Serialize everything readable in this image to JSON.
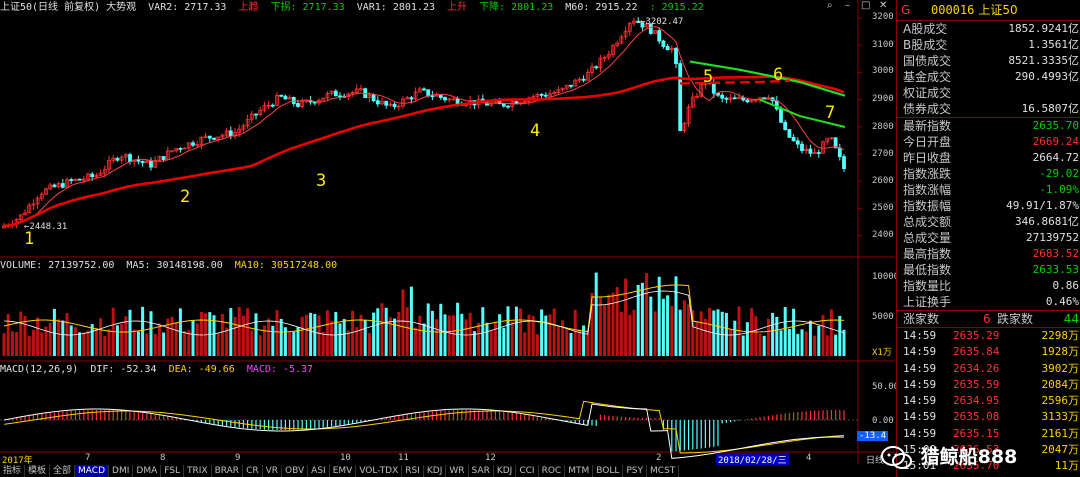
{
  "window": {
    "controls": [
      "⌕",
      "–",
      "□",
      "✕"
    ]
  },
  "main_header": {
    "title": "上证50(日线 前复权) 大势观",
    "var2": "VAR2: 2717.33",
    "up": "上趋",
    "down_arrow": "下拐: 2717.33",
    "var1": "VAR1: 2801.23",
    "up2": "上升",
    "down2": "下降: 2801.23",
    "m60": "M60: 2915.22",
    "m60b": ": 2915.22"
  },
  "volume_header": {
    "volume": "VOLUME: 27139752.00",
    "ma5": "MA5: 30148198.00",
    "ma10": "MA10: 30517248.00"
  },
  "macd_header": {
    "macd": "MACD(12,26,9)",
    "dif": "DIF: -52.34",
    "dea": "DEA: -49.66",
    "macdv": "MACD: -5.37"
  },
  "price_axis": [
    "3200",
    "3100",
    "3000",
    "2900",
    "2800",
    "2700",
    "2600",
    "2500",
    "2400"
  ],
  "volume_axis": [
    "10000",
    "5000"
  ],
  "volume_unit": "X1万",
  "macd_axis": [
    "50.00",
    "0.00"
  ],
  "macd_current": "-13.4",
  "x_labels": [
    "2017年",
    "7",
    "8",
    "9",
    "10",
    "11",
    "12",
    "2",
    "4"
  ],
  "cursor_date": "2018/02/28/三",
  "period": "日线",
  "annotations": {
    "high": "3202.47",
    "low": "2448.31",
    "marks": [
      "1",
      "2",
      "3",
      "4",
      "5",
      "6",
      "7"
    ]
  },
  "tabs": [
    "指标",
    "模板",
    "全部",
    "MACD",
    "DMI",
    "DMA",
    "FSL",
    "TRIX",
    "BRAR",
    "CR",
    "VR",
    "OBV",
    "ASI",
    "EMV",
    "VOL-TDX",
    "RSI",
    "KDJ",
    "WR",
    "SAR",
    "KDJ",
    "CCI",
    "ROC",
    "MTM",
    "BOLL",
    "PSY",
    "MCST"
  ],
  "active_tab": 3,
  "right_panel": {
    "g": "G",
    "code": "000016",
    "name": "上证50",
    "stats_a": [
      {
        "label": "A股成交",
        "value": "1852.9241亿",
        "color": "white"
      },
      {
        "label": "B股成交",
        "value": "1.3561亿",
        "color": "white"
      },
      {
        "label": "国债成交",
        "value": "8521.3335亿",
        "color": "white"
      },
      {
        "label": "基金成交",
        "value": "290.4993亿",
        "color": "white"
      },
      {
        "label": "权证成交",
        "value": "",
        "color": "white"
      },
      {
        "label": "债券成交",
        "value": "16.5807亿",
        "color": "white"
      }
    ],
    "stats_b": [
      {
        "label": "最新指数",
        "value": "2635.70",
        "color": "green"
      },
      {
        "label": "今日开盘",
        "value": "2669.24",
        "color": "red"
      },
      {
        "label": "昨日收盘",
        "value": "2664.72",
        "color": "white"
      },
      {
        "label": "指数涨跌",
        "value": "-29.02",
        "color": "green"
      },
      {
        "label": "指数涨幅",
        "value": "-1.09%",
        "color": "green"
      },
      {
        "label": "指数振幅",
        "value": "49.91/1.87%",
        "color": "white"
      },
      {
        "label": "总成交额",
        "value": "346.8681亿",
        "color": "white"
      },
      {
        "label": "总成交量",
        "value": "27139752",
        "color": "white"
      },
      {
        "label": "最高指数",
        "value": "2683.52",
        "color": "red"
      },
      {
        "label": "最低指数",
        "value": "2633.53",
        "color": "green"
      },
      {
        "label": "指数量比",
        "value": "0.86",
        "color": "white"
      },
      {
        "label": "上证换手",
        "value": "0.46%",
        "color": "white"
      }
    ],
    "up_count_label": "涨家数",
    "up_count": "6",
    "down_count_label": "跌家数",
    "down_count": "44",
    "ticks": [
      {
        "t": "14:59",
        "p": "2635.29",
        "v": "2298万"
      },
      {
        "t": "14:59",
        "p": "2635.84",
        "v": "1928万"
      },
      {
        "t": "14:59",
        "p": "2634.26",
        "v": "3902万"
      },
      {
        "t": "14:59",
        "p": "2635.59",
        "v": "2084万"
      },
      {
        "t": "14:59",
        "p": "2634.95",
        "v": "2596万"
      },
      {
        "t": "14:59",
        "p": "2635.08",
        "v": "3133万"
      },
      {
        "t": "14:59",
        "p": "2635.15",
        "v": "2161万"
      },
      {
        "t": "15:00",
        "p": "2636.53",
        "v": "2047万"
      },
      {
        "t": "15:01",
        "p": "2635.70",
        "v": "11万"
      }
    ]
  },
  "watermark": "猎鲸船888"
}
